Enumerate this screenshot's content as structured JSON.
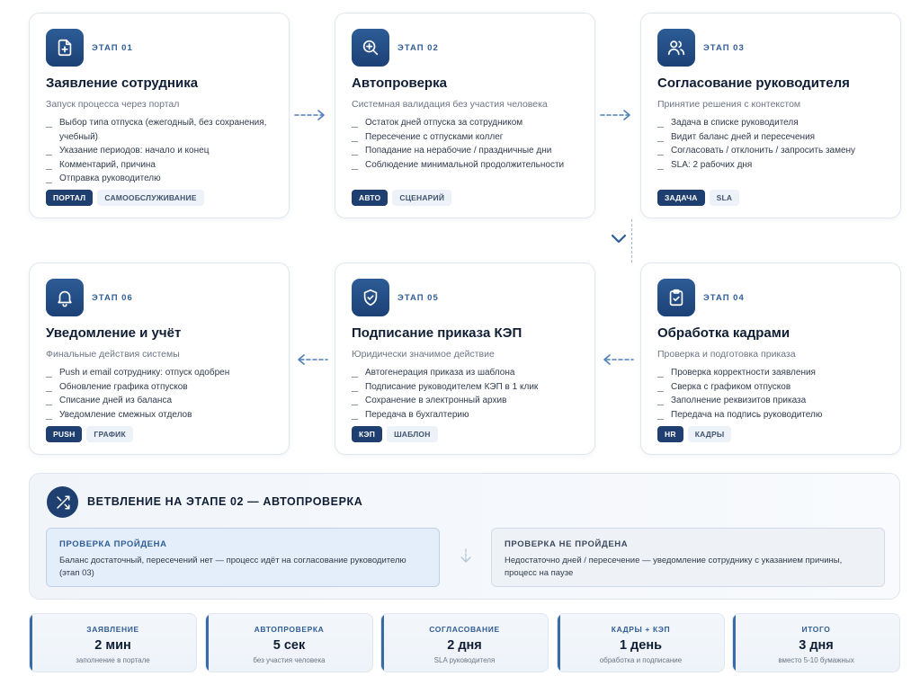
{
  "stages": [
    {
      "stage": "ЭТАП 01",
      "icon": "file-plus-icon",
      "title": "Заявление сотрудника",
      "subtitle": "Запуск процесса через портал",
      "items": [
        "Выбор типа отпуска (ежегодный, без сохранения, учебный)",
        "Указание периодов: начало и конец",
        "Комментарий, причина",
        "Отправка руководителю"
      ],
      "tags": [
        {
          "label": "ПОРТАЛ",
          "style": "dark"
        },
        {
          "label": "САМООБСЛУЖИВАНИЕ",
          "style": "light"
        }
      ]
    },
    {
      "stage": "ЭТАП 02",
      "icon": "zoom-in-icon",
      "title": "Автопроверка",
      "subtitle": "Системная валидация без участия человека",
      "items": [
        "Остаток дней отпуска за сотрудником",
        "Пересечение с отпусками коллег",
        "Попадание на нерабочие / праздничные дни",
        "Соблюдение минимальной продолжительности"
      ],
      "tags": [
        {
          "label": "АВТО",
          "style": "dark"
        },
        {
          "label": "СЦЕНАРИЙ",
          "style": "light"
        }
      ]
    },
    {
      "stage": "ЭТАП 03",
      "icon": "users-icon",
      "title": "Согласование руководителя",
      "subtitle": "Принятие решения с контекстом",
      "items": [
        "Задача в списке руководителя",
        "Видит баланс дней и пересечения",
        "Согласовать / отклонить / запросить замену",
        "SLA: 2 рабочих дня"
      ],
      "tags": [
        {
          "label": "ЗАДАЧА",
          "style": "dark"
        },
        {
          "label": "SLA",
          "style": "light"
        }
      ]
    },
    {
      "stage": "ЭТАП 04",
      "icon": "clipboard-check-icon",
      "title": "Обработка кадрами",
      "subtitle": "Проверка и подготовка приказа",
      "items": [
        "Проверка корректности заявления",
        "Сверка с графиком отпусков",
        "Заполнение реквизитов приказа",
        "Передача на подпись руководителю"
      ],
      "tags": [
        {
          "label": "HR",
          "style": "dark"
        },
        {
          "label": "КАДРЫ",
          "style": "light"
        }
      ]
    },
    {
      "stage": "ЭТАП 05",
      "icon": "shield-check-icon",
      "title": "Подписание приказа КЭП",
      "subtitle": "Юридически значимое действие",
      "items": [
        "Автогенерация приказа из шаблона",
        "Подписание руководителем КЭП в 1 клик",
        "Сохранение в электронный архив",
        "Передача в бухгалтерию"
      ],
      "tags": [
        {
          "label": "КЭП",
          "style": "dark"
        },
        {
          "label": "ШАБЛОН",
          "style": "light"
        }
      ]
    },
    {
      "stage": "ЭТАП 06",
      "icon": "bell-icon",
      "title": "Уведомление и учёт",
      "subtitle": "Финальные действия системы",
      "items": [
        "Push и email сотруднику: отпуск одобрен",
        "Обновление графика отпусков",
        "Списание дней из баланса",
        "Уведомление смежных отделов"
      ],
      "tags": [
        {
          "label": "PUSH",
          "style": "dark"
        },
        {
          "label": "ГРАФИК",
          "style": "light"
        }
      ]
    }
  ],
  "branch": {
    "icon": "shuffle-icon",
    "title": "ВЕТВЛЕНИЕ НА ЭТАПЕ 02 — АВТОПРОВЕРКА",
    "pass": {
      "title": "ПРОВЕРКА ПРОЙДЕНА",
      "text": "Баланс достаточный, пересечений нет — процесс идёт на согласование руководителю (этап 03)"
    },
    "fail": {
      "title": "ПРОВЕРКА НЕ ПРОЙДЕНА",
      "text": "Недостаточно дней / пересечение — уведомление сотруднику с указанием причины, процесс на паузе"
    }
  },
  "stats": [
    {
      "label": "ЗАЯВЛЕНИЕ",
      "value": "2 мин",
      "note": "заполнение в портале"
    },
    {
      "label": "АВТОПРОВЕРКА",
      "value": "5 сек",
      "note": "без участия человека"
    },
    {
      "label": "СОГЛАСОВАНИЕ",
      "value": "2 дня",
      "note": "SLA руководителя"
    },
    {
      "label": "КАДРЫ + КЭП",
      "value": "1 день",
      "note": "обработка и подписание"
    },
    {
      "label": "ИТОГО",
      "value": "3 дня",
      "note": "вместо 5-10 бумажных"
    }
  ],
  "colors": {
    "accent": "#1e3f6f",
    "accent_light": "#2f5d95",
    "arrow": "#4f7fb8"
  }
}
